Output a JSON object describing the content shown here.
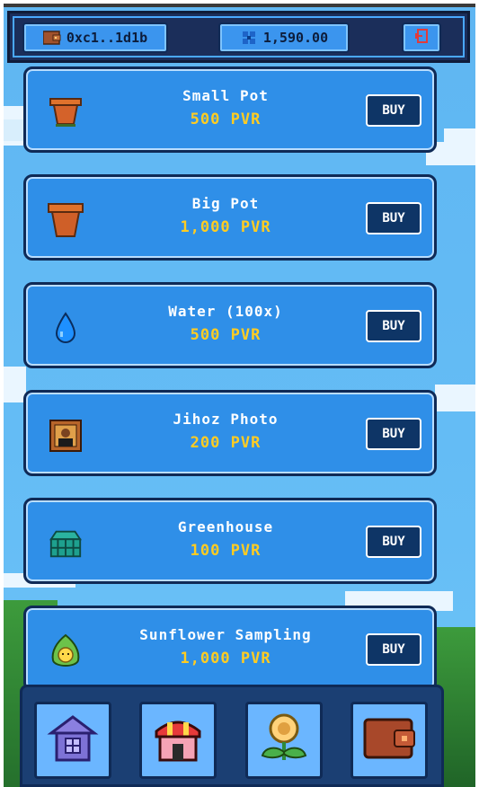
{
  "header": {
    "wallet_address": "0xc1..1d1b",
    "balance": "1,590.00",
    "wallet_icon": "wallet-icon",
    "balance_icon": "clover-icon",
    "logout_icon": "logout-icon"
  },
  "shop": {
    "buy_label": "BUY",
    "items": [
      {
        "name": "Small Pot",
        "price": "500 PVR",
        "icon": "small-pot-icon"
      },
      {
        "name": "Big Pot",
        "price": "1,000 PVR",
        "icon": "big-pot-icon"
      },
      {
        "name": "Water (100x)",
        "price": "500 PVR",
        "icon": "water-drop-icon"
      },
      {
        "name": "Jihoz Photo",
        "price": "200 PVR",
        "icon": "framed-photo-icon"
      },
      {
        "name": "Greenhouse",
        "price": "100 PVR",
        "icon": "greenhouse-icon"
      },
      {
        "name": "Sunflower Sampling",
        "price": "1,000 PVR",
        "icon": "sprout-icon"
      }
    ]
  },
  "nav": {
    "items": [
      {
        "icon": "house-icon"
      },
      {
        "icon": "shop-icon"
      },
      {
        "icon": "sunflower-icon"
      },
      {
        "icon": "wallet-icon"
      }
    ]
  },
  "colors": {
    "sky": "#64bcf5",
    "card": "#2f8fe8",
    "price": "#ffcc22",
    "buy_button": "#0e3566",
    "dark_border": "#0f2a56"
  }
}
